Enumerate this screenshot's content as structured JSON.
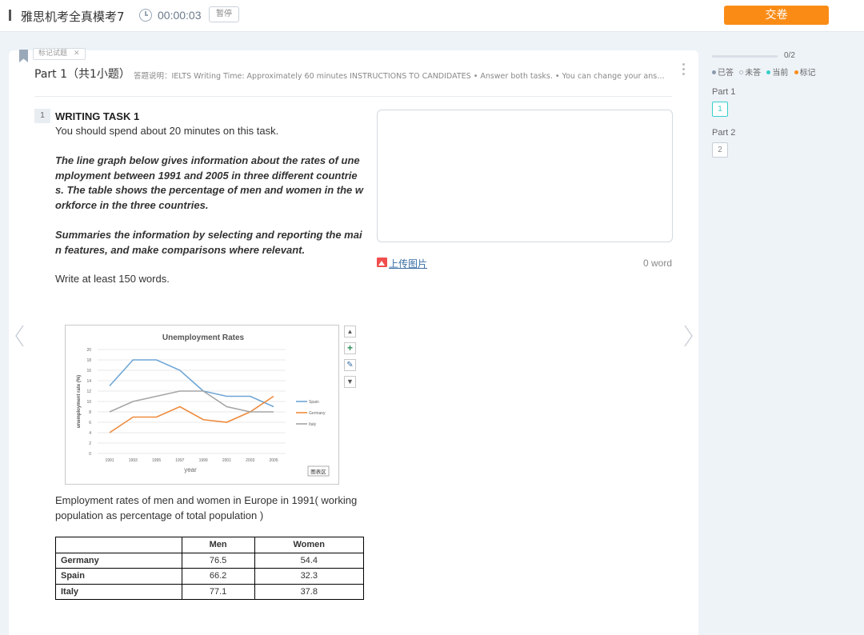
{
  "topbar": {
    "title": "雅思机考全真模考7",
    "timer": "00:00:03",
    "pause_label": "暂停",
    "submit_label": "交卷"
  },
  "colors": {
    "submit": "#fa8c16",
    "current": "#36cfc9",
    "answered": "#8c9bb0",
    "marked": "#fa8c16",
    "spain": "#6ea6d6",
    "germany": "#ee8a3c",
    "italy": "#a5a5a5"
  },
  "part": {
    "tag_label": "标记试题",
    "title": "Part 1（共1小题）",
    "description": "答题说明：IELTS Writing Time: Approximately 60 minutes INSTRUCTIONS TO CANDIDATES • Answer both tasks. • You can change your answers at any time during the test."
  },
  "question": {
    "number": "1",
    "title": "WRITING TASK 1",
    "time_note": "You should spend about 20 minutes on this task.",
    "prompt": "The line graph below gives information about the rates of unemployment between 1991 and 2005 in three different countries. The table shows the percentage of men and women in the workforce in the three countries.",
    "instruction": "Summaries the information by selecting and reporting the main features, and make comparisons where relevant.",
    "min_words": "Write at least 150 words."
  },
  "chart_data": {
    "type": "line",
    "title": "Unemployment Rates",
    "xlabel": "year",
    "ylabel": "unemployment rate (%)",
    "x": [
      "1991",
      "1993",
      "1995",
      "1997",
      "1999",
      "2001",
      "2003",
      "2005"
    ],
    "ylim": [
      0,
      20
    ],
    "yticks": [
      0,
      2,
      4,
      6,
      8,
      10,
      12,
      14,
      16,
      18,
      20
    ],
    "grid": true,
    "legend_position": "right",
    "series": [
      {
        "name": "Spain",
        "values": [
          13,
          18,
          18,
          16,
          12,
          11,
          11,
          9
        ]
      },
      {
        "name": "Germany",
        "values": [
          4,
          7,
          7,
          9,
          6.5,
          6,
          8,
          11
        ]
      },
      {
        "name": "Italy",
        "values": [
          8,
          10,
          11,
          12,
          12,
          9,
          8,
          8
        ]
      }
    ],
    "chart_area_button": "图表区"
  },
  "table": {
    "caption": "Employment rates of men and women in Europe in 1991( working population as percentage of total population )",
    "headers": [
      "",
      "Men",
      "Women"
    ],
    "rows": [
      {
        "country": "Germany",
        "men": "76.5",
        "women": "54.4"
      },
      {
        "country": "Spain",
        "men": "66.2",
        "women": "32.3"
      },
      {
        "country": "Italy",
        "men": "77.1",
        "women": "37.8"
      }
    ]
  },
  "answer": {
    "value": "",
    "upload_label": "上传图片",
    "word_count": "0 word"
  },
  "sidebar": {
    "progress_text": "0/2",
    "progress_fraction": 0,
    "legend": {
      "answered": "已答",
      "unanswered": "未答",
      "current": "当前",
      "marked": "标记"
    },
    "parts": [
      {
        "label": "Part 1",
        "questions": [
          "1"
        ]
      },
      {
        "label": "Part 2",
        "questions": [
          "2"
        ]
      }
    ]
  }
}
